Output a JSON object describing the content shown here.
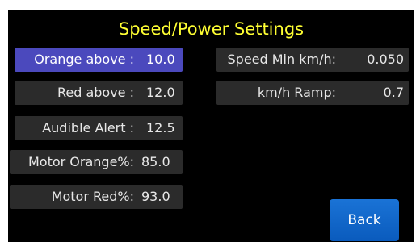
{
  "title": "Speed/Power Settings",
  "accent_color": "#ffff33",
  "selected_color": "#4b49bd",
  "left_fields": [
    {
      "label": "Orange above :",
      "value": "10.0"
    },
    {
      "label": "Red above :",
      "value": "12.0"
    },
    {
      "label": "Audible Alert :",
      "value": "12.5"
    },
    {
      "label": "Motor Orange%:",
      "value": "85.0"
    },
    {
      "label": "Motor Red%:",
      "value": "93.0"
    }
  ],
  "right_fields": [
    {
      "label": "Speed Min km/h:",
      "value": "0.050"
    },
    {
      "label": "km/h Ramp:",
      "value": "0.7"
    }
  ],
  "back_label": "Back"
}
